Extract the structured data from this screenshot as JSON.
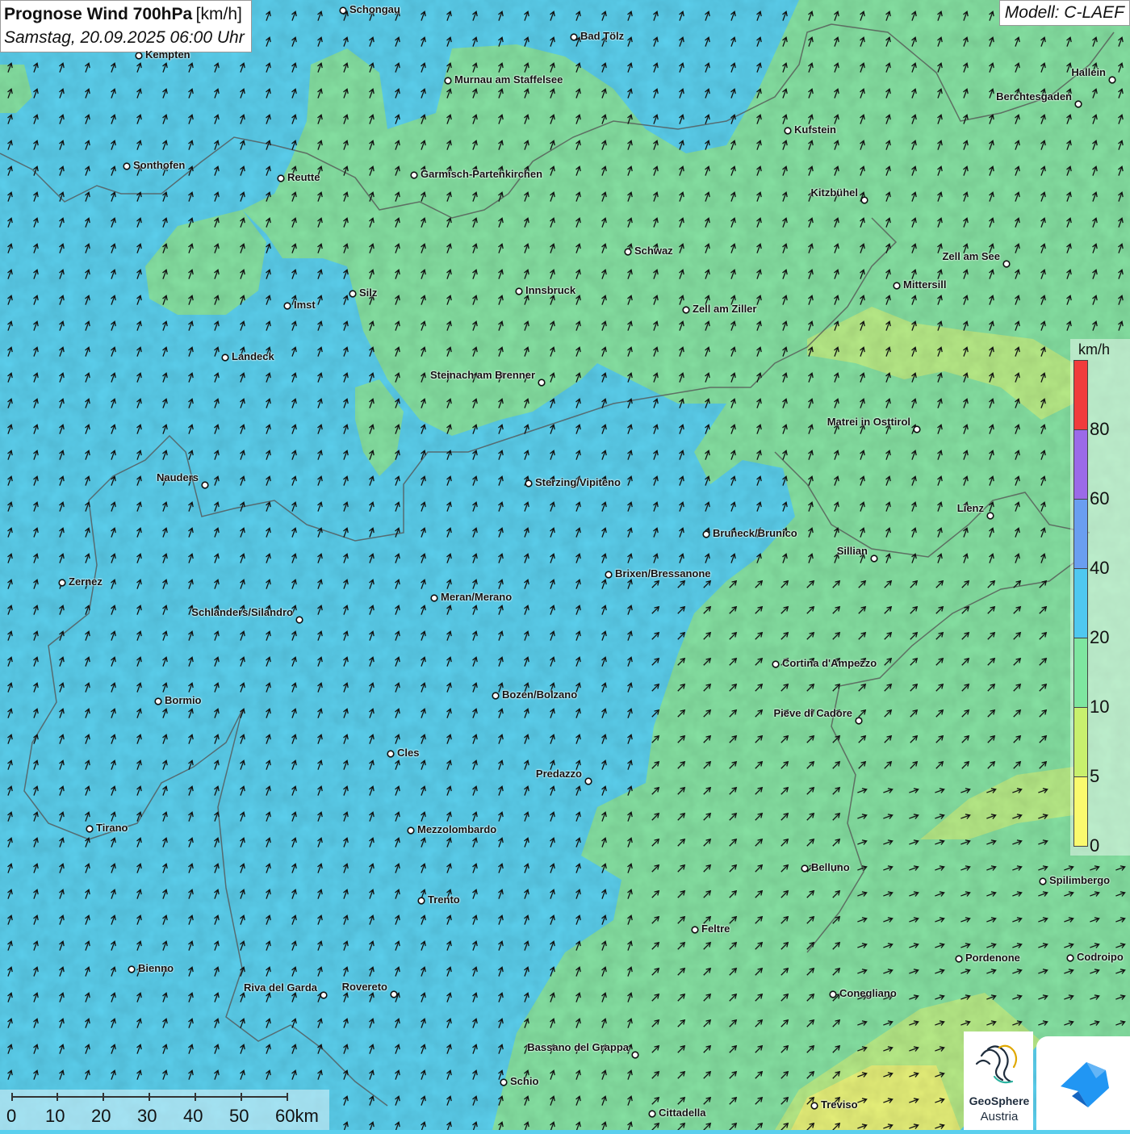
{
  "title": {
    "main": "Prognose Wind 700hPa",
    "unit": "[km/h]",
    "datetime": "Samstag, 20.09.2025 06:00 Uhr"
  },
  "model": "Modell: C-LAEF",
  "legend": {
    "unit": "km/h",
    "bins": [
      {
        "label": "80",
        "color": "#f03c3c"
      },
      {
        "label": "60",
        "color": "#9b6ae8"
      },
      {
        "label": "40",
        "color": "#6a9ef0"
      },
      {
        "label": "20",
        "color": "#4fc8f0"
      },
      {
        "label": "10",
        "color": "#7ee6a0"
      },
      {
        "label": "5",
        "color": "#c8f06e"
      },
      {
        "label": "0",
        "color": "#fafa6e"
      }
    ],
    "bottom_label": "0"
  },
  "scalebar": {
    "labels": [
      "0",
      "10",
      "20",
      "30",
      "40",
      "50",
      "60km"
    ]
  },
  "cities": [
    {
      "name": "Schongau"
    },
    {
      "name": "Bad Tölz"
    },
    {
      "name": "Kempten"
    },
    {
      "name": "Murnau am Staffelsee"
    },
    {
      "name": "Hallein"
    },
    {
      "name": "Berchtesgaden"
    },
    {
      "name": "Kufstein"
    },
    {
      "name": "Sonthofen"
    },
    {
      "name": "Reutte"
    },
    {
      "name": "Garmisch-Partenkirchen"
    },
    {
      "name": "Kitzbühel"
    },
    {
      "name": "Schwaz"
    },
    {
      "name": "Zell am See"
    },
    {
      "name": "Mittersill"
    },
    {
      "name": "Innsbruck"
    },
    {
      "name": "Silz"
    },
    {
      "name": "Imst"
    },
    {
      "name": "Zell am Ziller"
    },
    {
      "name": "Landeck"
    },
    {
      "name": "Steinach am Brenner"
    },
    {
      "name": "Matrei in Osttirol"
    },
    {
      "name": "Nauders"
    },
    {
      "name": "Sterzing/Vipiteno"
    },
    {
      "name": "Lienz"
    },
    {
      "name": "Bruneck/Brunico"
    },
    {
      "name": "Sillian"
    },
    {
      "name": "Brixen/Bressanone"
    },
    {
      "name": "Zernez"
    },
    {
      "name": "Meran/Merano"
    },
    {
      "name": "Schlanders/Silandro"
    },
    {
      "name": "Cortina d'Ampezzo"
    },
    {
      "name": "Bozen/Bolzano"
    },
    {
      "name": "Bormio"
    },
    {
      "name": "Pieve di Cadore"
    },
    {
      "name": "Cles"
    },
    {
      "name": "Predazzo"
    },
    {
      "name": "Tirano"
    },
    {
      "name": "Mezzolombardo"
    },
    {
      "name": "Belluno"
    },
    {
      "name": "Spilimbergo"
    },
    {
      "name": "Trento"
    },
    {
      "name": "Feltre"
    },
    {
      "name": "Pordenone"
    },
    {
      "name": "Codroipo"
    },
    {
      "name": "Bienno"
    },
    {
      "name": "Riva del Garda"
    },
    {
      "name": "Rovereto"
    },
    {
      "name": "Conegliano"
    },
    {
      "name": "Bassano del Grappa"
    },
    {
      "name": "Schio"
    },
    {
      "name": "Treviso"
    },
    {
      "name": "Cittadella"
    }
  ],
  "logo": {
    "name": "GeoSphere",
    "sub": "Austria"
  },
  "colors": {
    "band_20_40": "#5bd0ee",
    "band_10_20": "#86e2a3",
    "band_5_10": "#b8ec88",
    "band_0_5": "#e8f27a",
    "arrow": "#111111",
    "border": "#555555"
  },
  "arrow_direction": "north-northeast"
}
